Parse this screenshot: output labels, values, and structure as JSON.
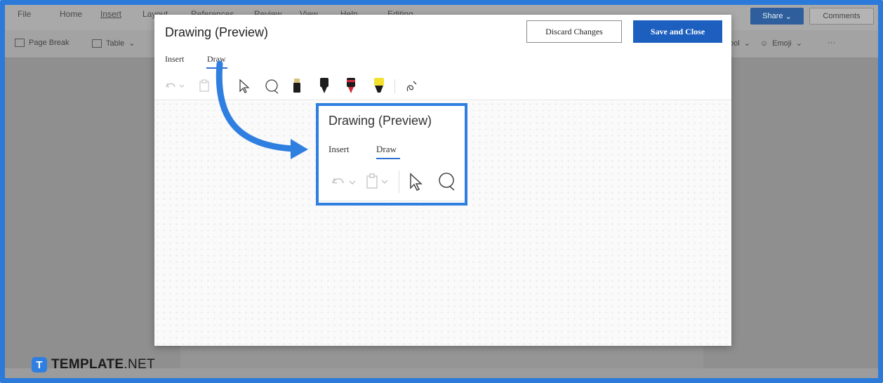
{
  "word": {
    "menu": [
      "File",
      "Home",
      "Insert",
      "Layout",
      "References",
      "Review",
      "View",
      "Help",
      "Editing"
    ],
    "active_menu": "Insert",
    "share_label": "Share",
    "comments_label": "Comments",
    "ribbon_left": [
      "Page Break",
      "Table"
    ],
    "ribbon_right": [
      "ool",
      "Emoji",
      "···"
    ]
  },
  "dialog": {
    "title": "Drawing (Preview)",
    "discard_label": "Discard Changes",
    "save_label": "Save and Close",
    "tabs": [
      "Insert",
      "Draw"
    ],
    "active_tab": "Draw",
    "tools": [
      "undo-icon",
      "clipboard-icon",
      "select-arrow-icon",
      "lasso-icon",
      "black-pen-icon",
      "black-marker-icon",
      "red-pen-icon",
      "yellow-highlighter-icon",
      "ink-to-shape-icon"
    ]
  },
  "callout": {
    "title": "Drawing (Preview)",
    "tabs": [
      "Insert",
      "Draw"
    ],
    "tools": [
      "undo-icon",
      "clipboard-icon",
      "select-arrow-icon",
      "lasso-icon"
    ]
  },
  "watermark": {
    "brand": "TEMPLATE",
    "suffix": ".NET",
    "mark": "T"
  },
  "colors": {
    "accent": "#2f7fe0",
    "save_button": "#1d5fbf",
    "red_pen": "#d42a3a",
    "highlighter": "#f2e22e"
  }
}
